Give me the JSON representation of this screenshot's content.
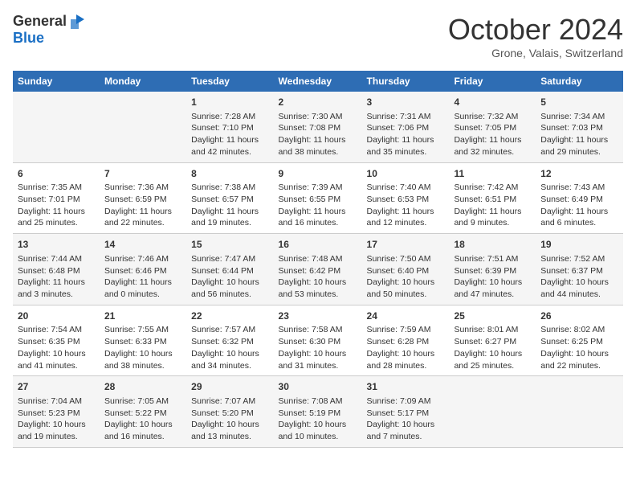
{
  "header": {
    "logo_general": "General",
    "logo_blue": "Blue",
    "month_title": "October 2024",
    "location": "Grone, Valais, Switzerland"
  },
  "days_of_week": [
    "Sunday",
    "Monday",
    "Tuesday",
    "Wednesday",
    "Thursday",
    "Friday",
    "Saturday"
  ],
  "weeks": [
    [
      {
        "day": "",
        "sunrise": "",
        "sunset": "",
        "daylight": ""
      },
      {
        "day": "",
        "sunrise": "",
        "sunset": "",
        "daylight": ""
      },
      {
        "day": "1",
        "sunrise": "Sunrise: 7:28 AM",
        "sunset": "Sunset: 7:10 PM",
        "daylight": "Daylight: 11 hours and 42 minutes."
      },
      {
        "day": "2",
        "sunrise": "Sunrise: 7:30 AM",
        "sunset": "Sunset: 7:08 PM",
        "daylight": "Daylight: 11 hours and 38 minutes."
      },
      {
        "day": "3",
        "sunrise": "Sunrise: 7:31 AM",
        "sunset": "Sunset: 7:06 PM",
        "daylight": "Daylight: 11 hours and 35 minutes."
      },
      {
        "day": "4",
        "sunrise": "Sunrise: 7:32 AM",
        "sunset": "Sunset: 7:05 PM",
        "daylight": "Daylight: 11 hours and 32 minutes."
      },
      {
        "day": "5",
        "sunrise": "Sunrise: 7:34 AM",
        "sunset": "Sunset: 7:03 PM",
        "daylight": "Daylight: 11 hours and 29 minutes."
      }
    ],
    [
      {
        "day": "6",
        "sunrise": "Sunrise: 7:35 AM",
        "sunset": "Sunset: 7:01 PM",
        "daylight": "Daylight: 11 hours and 25 minutes."
      },
      {
        "day": "7",
        "sunrise": "Sunrise: 7:36 AM",
        "sunset": "Sunset: 6:59 PM",
        "daylight": "Daylight: 11 hours and 22 minutes."
      },
      {
        "day": "8",
        "sunrise": "Sunrise: 7:38 AM",
        "sunset": "Sunset: 6:57 PM",
        "daylight": "Daylight: 11 hours and 19 minutes."
      },
      {
        "day": "9",
        "sunrise": "Sunrise: 7:39 AM",
        "sunset": "Sunset: 6:55 PM",
        "daylight": "Daylight: 11 hours and 16 minutes."
      },
      {
        "day": "10",
        "sunrise": "Sunrise: 7:40 AM",
        "sunset": "Sunset: 6:53 PM",
        "daylight": "Daylight: 11 hours and 12 minutes."
      },
      {
        "day": "11",
        "sunrise": "Sunrise: 7:42 AM",
        "sunset": "Sunset: 6:51 PM",
        "daylight": "Daylight: 11 hours and 9 minutes."
      },
      {
        "day": "12",
        "sunrise": "Sunrise: 7:43 AM",
        "sunset": "Sunset: 6:49 PM",
        "daylight": "Daylight: 11 hours and 6 minutes."
      }
    ],
    [
      {
        "day": "13",
        "sunrise": "Sunrise: 7:44 AM",
        "sunset": "Sunset: 6:48 PM",
        "daylight": "Daylight: 11 hours and 3 minutes."
      },
      {
        "day": "14",
        "sunrise": "Sunrise: 7:46 AM",
        "sunset": "Sunset: 6:46 PM",
        "daylight": "Daylight: 11 hours and 0 minutes."
      },
      {
        "day": "15",
        "sunrise": "Sunrise: 7:47 AM",
        "sunset": "Sunset: 6:44 PM",
        "daylight": "Daylight: 10 hours and 56 minutes."
      },
      {
        "day": "16",
        "sunrise": "Sunrise: 7:48 AM",
        "sunset": "Sunset: 6:42 PM",
        "daylight": "Daylight: 10 hours and 53 minutes."
      },
      {
        "day": "17",
        "sunrise": "Sunrise: 7:50 AM",
        "sunset": "Sunset: 6:40 PM",
        "daylight": "Daylight: 10 hours and 50 minutes."
      },
      {
        "day": "18",
        "sunrise": "Sunrise: 7:51 AM",
        "sunset": "Sunset: 6:39 PM",
        "daylight": "Daylight: 10 hours and 47 minutes."
      },
      {
        "day": "19",
        "sunrise": "Sunrise: 7:52 AM",
        "sunset": "Sunset: 6:37 PM",
        "daylight": "Daylight: 10 hours and 44 minutes."
      }
    ],
    [
      {
        "day": "20",
        "sunrise": "Sunrise: 7:54 AM",
        "sunset": "Sunset: 6:35 PM",
        "daylight": "Daylight: 10 hours and 41 minutes."
      },
      {
        "day": "21",
        "sunrise": "Sunrise: 7:55 AM",
        "sunset": "Sunset: 6:33 PM",
        "daylight": "Daylight: 10 hours and 38 minutes."
      },
      {
        "day": "22",
        "sunrise": "Sunrise: 7:57 AM",
        "sunset": "Sunset: 6:32 PM",
        "daylight": "Daylight: 10 hours and 34 minutes."
      },
      {
        "day": "23",
        "sunrise": "Sunrise: 7:58 AM",
        "sunset": "Sunset: 6:30 PM",
        "daylight": "Daylight: 10 hours and 31 minutes."
      },
      {
        "day": "24",
        "sunrise": "Sunrise: 7:59 AM",
        "sunset": "Sunset: 6:28 PM",
        "daylight": "Daylight: 10 hours and 28 minutes."
      },
      {
        "day": "25",
        "sunrise": "Sunrise: 8:01 AM",
        "sunset": "Sunset: 6:27 PM",
        "daylight": "Daylight: 10 hours and 25 minutes."
      },
      {
        "day": "26",
        "sunrise": "Sunrise: 8:02 AM",
        "sunset": "Sunset: 6:25 PM",
        "daylight": "Daylight: 10 hours and 22 minutes."
      }
    ],
    [
      {
        "day": "27",
        "sunrise": "Sunrise: 7:04 AM",
        "sunset": "Sunset: 5:23 PM",
        "daylight": "Daylight: 10 hours and 19 minutes."
      },
      {
        "day": "28",
        "sunrise": "Sunrise: 7:05 AM",
        "sunset": "Sunset: 5:22 PM",
        "daylight": "Daylight: 10 hours and 16 minutes."
      },
      {
        "day": "29",
        "sunrise": "Sunrise: 7:07 AM",
        "sunset": "Sunset: 5:20 PM",
        "daylight": "Daylight: 10 hours and 13 minutes."
      },
      {
        "day": "30",
        "sunrise": "Sunrise: 7:08 AM",
        "sunset": "Sunset: 5:19 PM",
        "daylight": "Daylight: 10 hours and 10 minutes."
      },
      {
        "day": "31",
        "sunrise": "Sunrise: 7:09 AM",
        "sunset": "Sunset: 5:17 PM",
        "daylight": "Daylight: 10 hours and 7 minutes."
      },
      {
        "day": "",
        "sunrise": "",
        "sunset": "",
        "daylight": ""
      },
      {
        "day": "",
        "sunrise": "",
        "sunset": "",
        "daylight": ""
      }
    ]
  ]
}
